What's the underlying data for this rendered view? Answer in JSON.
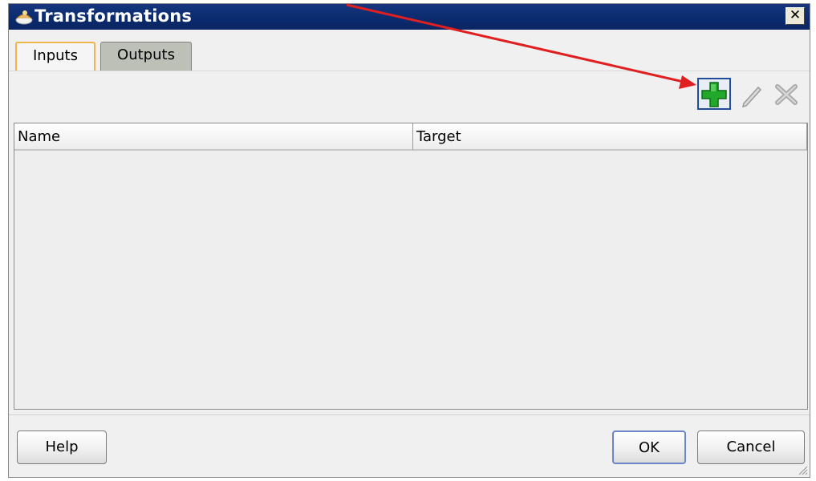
{
  "window": {
    "title": "Transformations",
    "close_glyph": "✕"
  },
  "tabs": [
    {
      "label": "Inputs",
      "selected": true
    },
    {
      "label": "Outputs",
      "selected": false
    }
  ],
  "toolbar": {
    "icons": [
      "add-icon",
      "edit-icon",
      "delete-icon"
    ]
  },
  "table": {
    "columns": [
      "Name",
      "Target"
    ],
    "rows": []
  },
  "buttons": {
    "help": "Help",
    "ok": "OK",
    "cancel": "Cancel"
  },
  "colors": {
    "titlebar": "#0a2a6e",
    "annotation_arrow": "#e02020",
    "add_icon": "#22a82a"
  }
}
